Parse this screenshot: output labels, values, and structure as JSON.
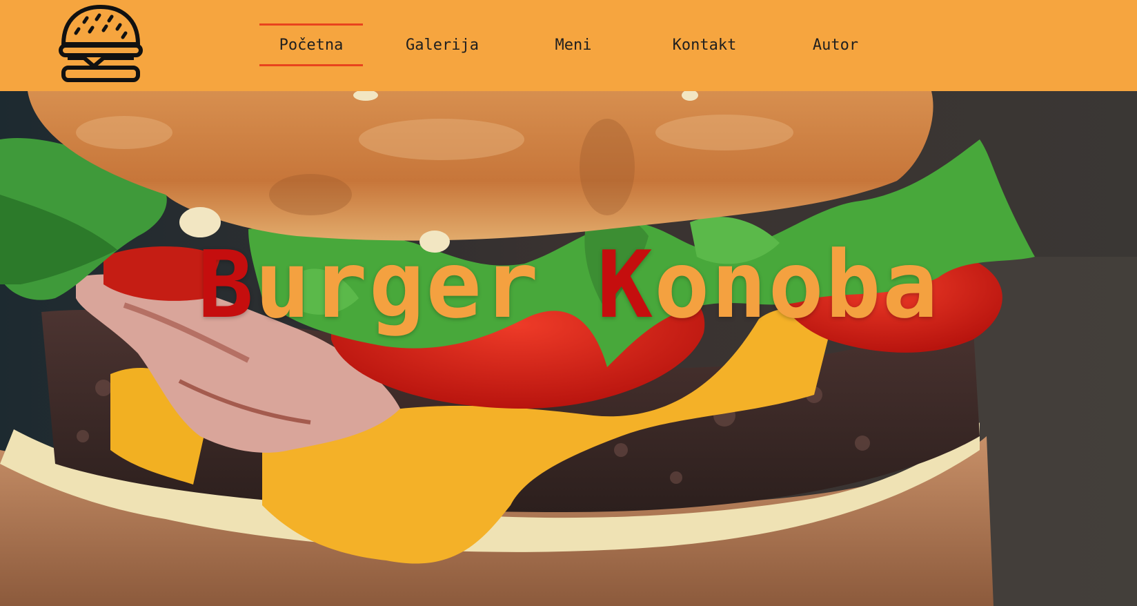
{
  "nav": {
    "logo_icon": "burger-icon",
    "items": [
      {
        "label": "Početna",
        "active": true
      },
      {
        "label": "Galerija",
        "active": false
      },
      {
        "label": "Meni",
        "active": false
      },
      {
        "label": "Kontakt",
        "active": false
      },
      {
        "label": "Autor",
        "active": false
      }
    ]
  },
  "hero": {
    "word1_initial": "B",
    "word1_rest": "urger",
    "word2_initial": "K",
    "word2_rest": "onoba",
    "image_icon": "burger-photo"
  },
  "colors": {
    "navbar_bg": "#f6a53f",
    "active_underline": "#e8431d",
    "title_orange": "#f4a140",
    "title_red": "#c50e0e"
  }
}
